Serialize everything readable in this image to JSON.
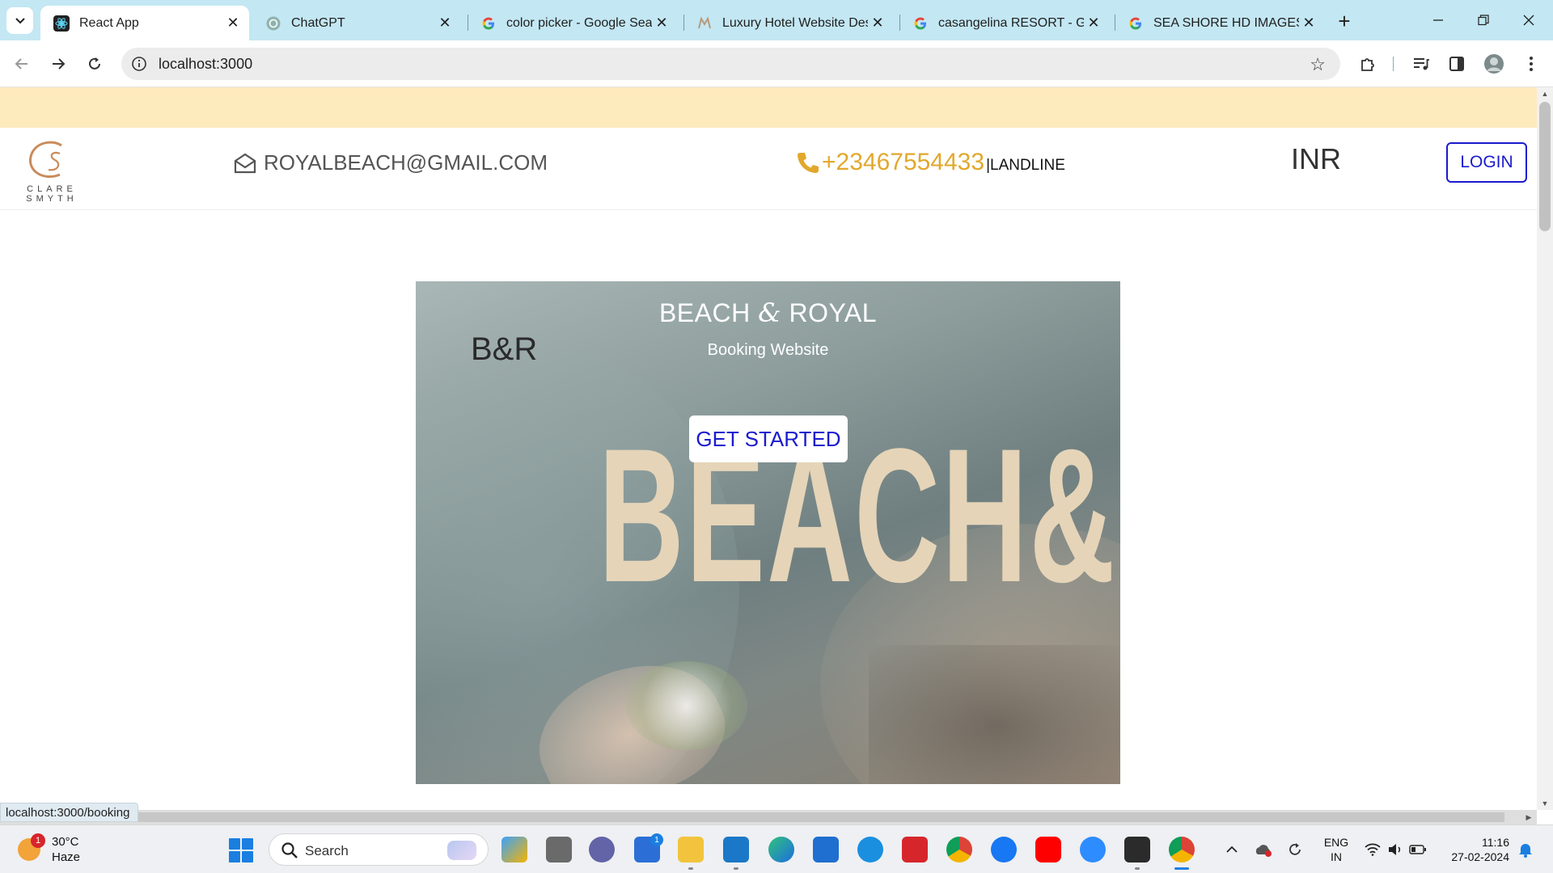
{
  "browser": {
    "tabs": [
      {
        "title": "React App",
        "active": true,
        "icon": "react-icon"
      },
      {
        "title": "ChatGPT",
        "active": false,
        "icon": "chatgpt-icon"
      },
      {
        "title": "color picker - Google Searc",
        "active": false,
        "icon": "google-icon"
      },
      {
        "title": "Luxury Hotel Website Desig",
        "active": false,
        "icon": "dribbble-icon"
      },
      {
        "title": "casangelina RESORT - Goo",
        "active": false,
        "icon": "google-icon"
      },
      {
        "title": "SEA SHORE HD IMAGES - (",
        "active": false,
        "icon": "google-icon"
      }
    ],
    "url": "localhost:3000",
    "status_url": "localhost:3000/booking"
  },
  "page": {
    "logo": {
      "line1": "CLARE",
      "line2": "SMYTH"
    },
    "email": "ROYALBEACH@GMAIL.COM",
    "phone": "+23467554433",
    "phone_suffix": "|LANDLINE",
    "currency": "INR",
    "login_label": "LOGIN",
    "hero": {
      "title_left": "BEACH",
      "title_amp": "&",
      "title_right": "ROYAL",
      "subtitle": "Booking Website",
      "mark": "B&R",
      "cta_label": "GET STARTED",
      "big_word": "BEACH&"
    }
  },
  "taskbar": {
    "weather_temp": "30°C",
    "weather_cond": "Haze",
    "weather_badge": "1",
    "search_placeholder": "Search",
    "store_badge": "1",
    "lang_line1": "ENG",
    "lang_line2": "IN",
    "time": "11:16",
    "date": "27-02-2024"
  },
  "colors": {
    "accent_blue": "#1a1acf",
    "phone_gold": "#e2a82c",
    "top_strip": "#fdeabd",
    "tabbar": "#c3e7f3"
  }
}
